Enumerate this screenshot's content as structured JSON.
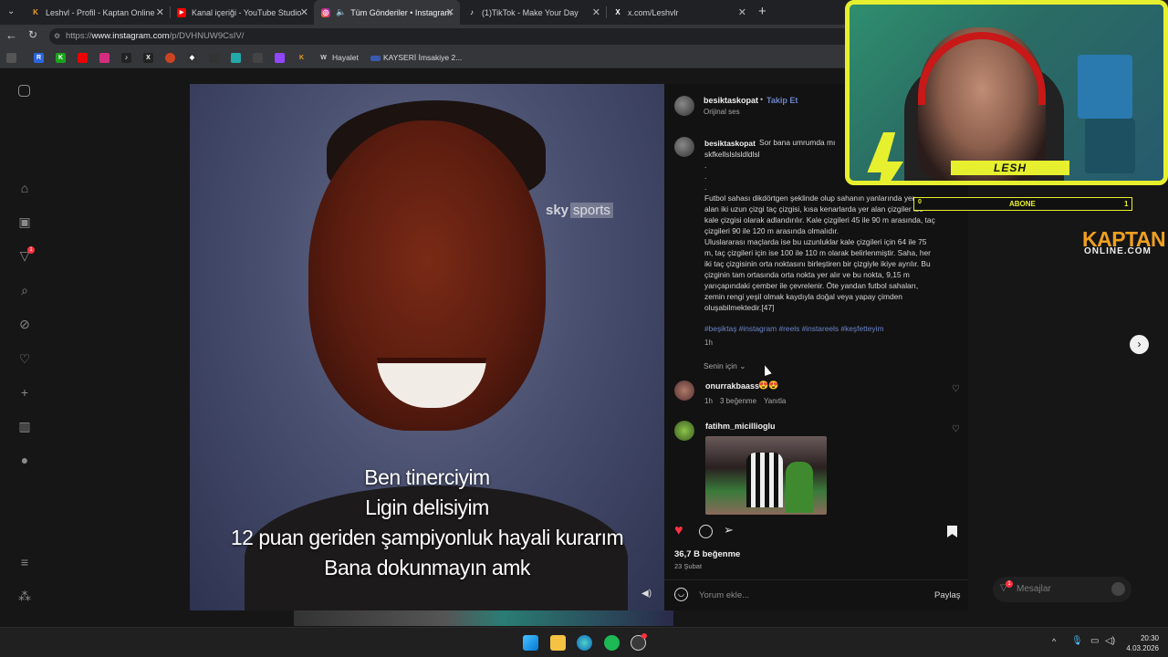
{
  "browser": {
    "tabs": [
      {
        "title": "Leshvl - Profil - Kaptan Online",
        "favicon": "K"
      },
      {
        "title": "Kanal içeriği - YouTube Studio",
        "favicon": "▶"
      },
      {
        "title": "Tüm Gönderiler • Instagram",
        "favicon": "◎"
      },
      {
        "title": "(1)TikTok - Make Your Day",
        "favicon": "♪"
      },
      {
        "title": "x.com/Leshvlr",
        "favicon": "X"
      }
    ],
    "new_tab": "+",
    "url_prefix": "https://",
    "url_host": "www.instagram.com",
    "url_path": "/p/DVHNUW9CsIV/",
    "bookmarks": {
      "hayalet": "Hayalet",
      "kayseri": "KAYSERİ İmsakiye 2..."
    }
  },
  "post": {
    "author": "besiktaskopat",
    "follow": "Takip Et",
    "audio": "Orijinal ses",
    "caption_lines": [
      "besiktaskopat Sor bana umrumda mı",
      "skfkellslslsldldlsl",
      ".",
      ".",
      ".",
      "Futbol sahası dikdörtgen şeklinde olup sahanın yanlarında yer",
      "alan iki uzun çizgi taç çizgisi, kısa kenarlarda yer alan çizgiler ise",
      "kale çizgisi olarak adlandırılır. Kale çizgileri 45 ile 90 m arasında, taç",
      "çizgileri 90 ile 120 m arasında olmalıdır.",
      "Uluslararası maçlarda ise bu uzunluklar kale çizgileri için 64 ile 75",
      "m, taç çizgileri için ise 100 ile 110 m olarak belirlenmiştir. Saha, her",
      "iki taç çizgisinin orta noktasını birleştiren bir çizgiyle ikiye ayrılır. Bu",
      "çizginin tam ortasında orta nokta yer alır ve bu nokta, 9,15 m",
      "yarıçapındaki çember ile çevrelenir. Öte yandan futbol sahaları,",
      "zemin rengi yeşil olmak kaydıyla doğal veya yapay çimden",
      "oluşabilmektedir.[47]"
    ],
    "caption_author": "besiktaskopat",
    "hashtags": "#beşiktaş #instagram #reels #instareels #keşfetteyim",
    "caption_time": "1h",
    "sort": "Senin için",
    "comments": [
      {
        "user": "onurrakbaass",
        "text": "😍😍",
        "time": "1h",
        "likes": "3 beğenme",
        "reply": "Yanıtla"
      },
      {
        "user": "fatihm_micillioglu",
        "text": "",
        "time": "",
        "likes": "",
        "reply": ""
      }
    ],
    "likes": "36,7 B beğenme",
    "date": "23 Şubat",
    "comment_placeholder": "Yorum ekle...",
    "share": "Paylaş"
  },
  "video": {
    "watermark_a": "sky",
    "watermark_b": "sports",
    "subtitles": [
      "Ben tinerciyim",
      "Ligin delisiyim",
      "12 puan geriden şampiyonluk hayali kurarım",
      "Bana dokunmayın amk"
    ]
  },
  "overlay": {
    "streamer": "LESH",
    "abone_label": "ABONE",
    "abone_count": "1",
    "abone_left": "0",
    "brand_main": "KAPTAN",
    "brand_sub": "ONLINE.COM"
  },
  "messages": {
    "label": "Mesajlar",
    "badge": "1"
  },
  "rail": {
    "notification_badge": "1"
  },
  "clock": {
    "time": "20:30",
    "date": "4.03.2026"
  },
  "colors": {
    "accent_yellow": "#e7f02e",
    "ig_blue": "#6b84c8",
    "heart_red": "#ff3040"
  }
}
